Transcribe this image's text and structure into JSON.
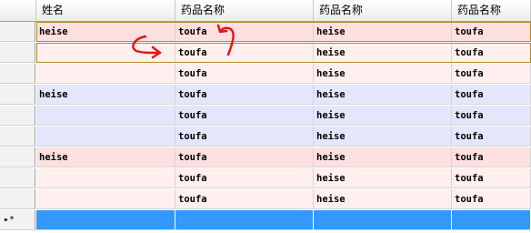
{
  "columns": [
    "姓名",
    "药品名称",
    "药品名称",
    "药品名称"
  ],
  "rows": [
    {
      "cells": [
        "heise",
        "toufa",
        "heise",
        "toufa"
      ],
      "bg": "#ffe0e0"
    },
    {
      "cells": [
        "",
        "toufa",
        "heise",
        "toufa"
      ],
      "bg": "#ffefef"
    },
    {
      "cells": [
        "",
        "toufa",
        "heise",
        "toufa"
      ],
      "bg": "#ffefef"
    },
    {
      "cells": [
        "heise",
        "toufa",
        "heise",
        "toufa"
      ],
      "bg": "#e4e6fb"
    },
    {
      "cells": [
        "",
        "toufa",
        "heise",
        "toufa"
      ],
      "bg": "#e4e6fb"
    },
    {
      "cells": [
        "",
        "toufa",
        "heise",
        "toufa"
      ],
      "bg": "#e4e6fb"
    },
    {
      "cells": [
        "heise",
        "toufa",
        "heise",
        "toufa"
      ],
      "bg": "#ffe0e0"
    },
    {
      "cells": [
        "",
        "toufa",
        "heise",
        "toufa"
      ],
      "bg": "#ffefef"
    },
    {
      "cells": [
        "",
        "toufa",
        "heise",
        "toufa"
      ],
      "bg": "#ffefef"
    }
  ],
  "new_row": {
    "marker": "▸*",
    "bg": "#3399ff"
  },
  "colors": {
    "annotation": "#e01818",
    "selection_outline": "#b08a2a"
  }
}
